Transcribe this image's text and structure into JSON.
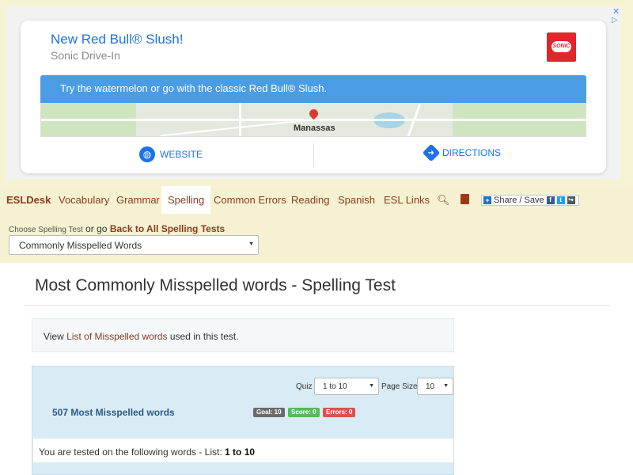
{
  "ad": {
    "title": "New Red Bull® Slush!",
    "subtitle": "Sonic Drive-In",
    "logo_text": "SONIC",
    "banner": "Try the watermelon or go with the classic Red Bull® Slush.",
    "map_label": "Manassas",
    "website_label": "WEBSITE",
    "directions_label": "DIRECTIONS",
    "website_icon": "globe-icon",
    "directions_icon": "directions-arrow-icon",
    "adchoices_close": "✕",
    "adchoices_play": "▷"
  },
  "nav": {
    "brand": "ESLDesk",
    "items": [
      "Vocabulary",
      "Grammar",
      "Spelling",
      "Common Errors",
      "Reading",
      "Spanish",
      "ESL Links"
    ],
    "active": "Spelling",
    "search_icon": "search-icon",
    "book_icon": "book-icon",
    "share_label": "Share / Save"
  },
  "choose": {
    "small_label": "Choose Spelling Test",
    "or_go": "or go",
    "back_link": "Back to All Spelling Tests",
    "selected": "Commonly Misspelled Words"
  },
  "main": {
    "title": "Most Commonly Misspelled words - Spelling Test",
    "info_prefix": "View",
    "info_link": "List of Misspelled words",
    "info_suffix": "used in this test."
  },
  "quiz": {
    "quiz_label": "Quiz",
    "quiz_value": "1 to 10",
    "page_size_label": "Page Size",
    "page_size_value": "10",
    "heading": "507 Most Misspelled words",
    "goal": "Goal: 10",
    "score": "Score: 0",
    "errors": "Errors: 0",
    "words_prefix": "You are tested on the following words - List:",
    "words_range": "1 to 10"
  },
  "colors": {
    "nav_bg": "#f6f1d0",
    "link_brown": "#8b3b1f",
    "ad_blue": "#4a9de5",
    "panel_blue": "#d9ebf5"
  }
}
